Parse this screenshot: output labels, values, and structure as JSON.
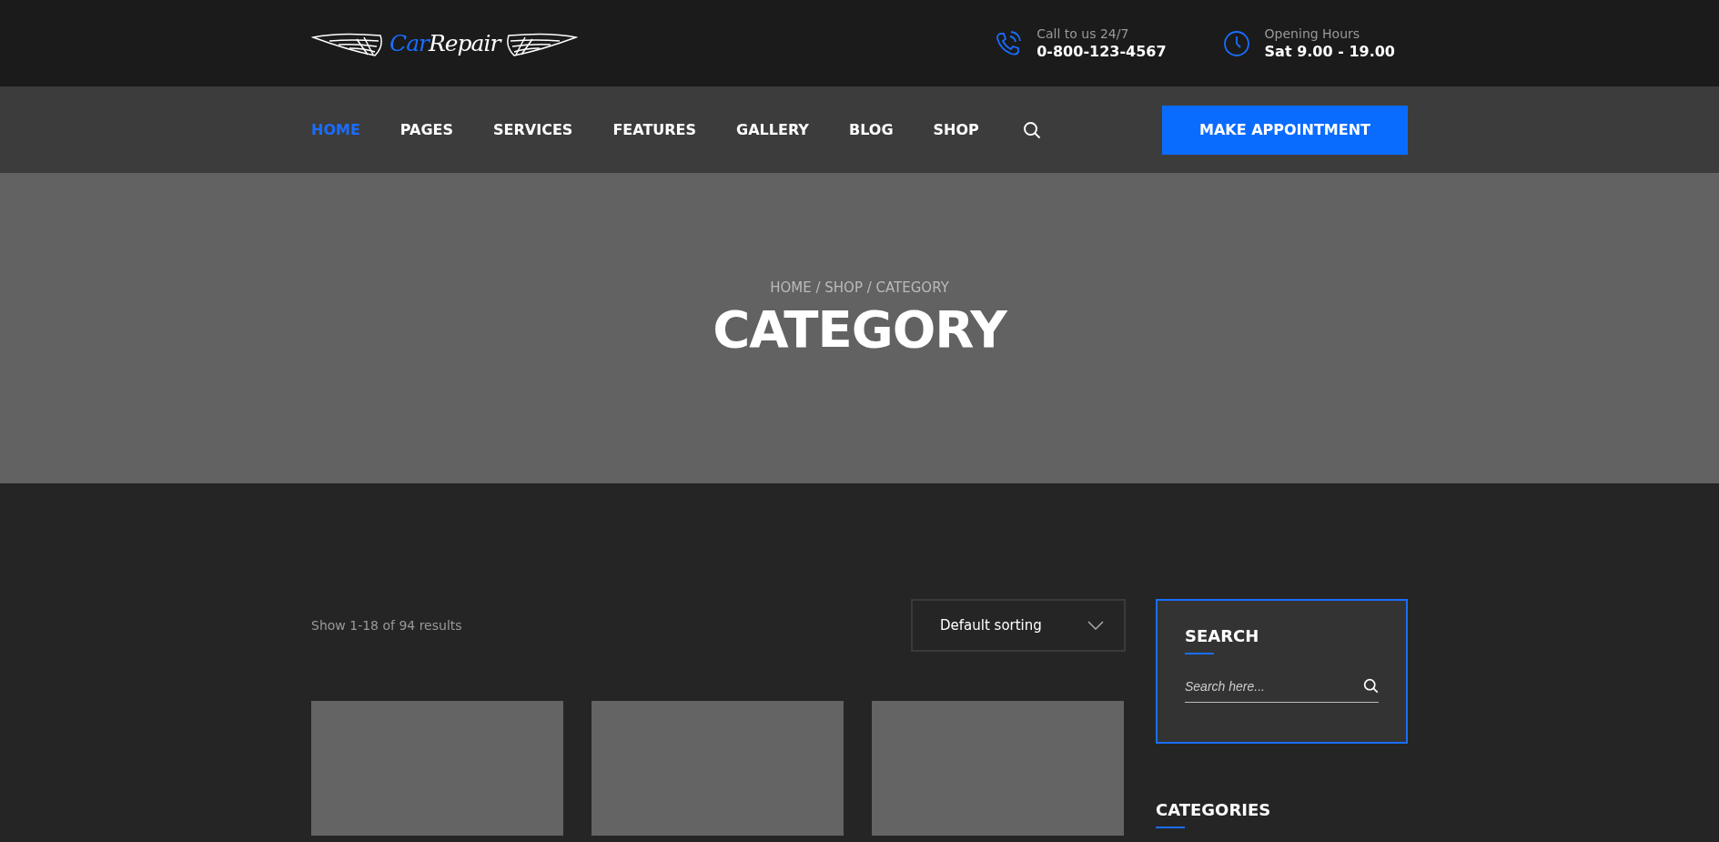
{
  "logo": {
    "parts": [
      {
        "text": "Car",
        "accent": true
      },
      {
        "text": "Repair",
        "accent": false
      }
    ]
  },
  "contacts": [
    {
      "kind": "phone",
      "label": "Call to us 24/7",
      "value": "0-800-123-4567"
    },
    {
      "kind": "clock",
      "label": "Opening Hours",
      "value": "Sat 9.00 - 19.00"
    }
  ],
  "nav": {
    "items": [
      {
        "label": "HOME",
        "selected": true
      },
      {
        "label": "PAGES",
        "selected": false
      },
      {
        "label": "SERVICES",
        "selected": false
      },
      {
        "label": "FEATURES",
        "selected": false
      },
      {
        "label": "GALLERY",
        "selected": false
      },
      {
        "label": "BLOG",
        "selected": false
      },
      {
        "label": "SHOP",
        "selected": false
      }
    ],
    "button": "MAKE APPOINTMENT"
  },
  "hero": {
    "breadcrumb": "HOME / SHOP / CATEGORY",
    "title": "CATEGORY"
  },
  "shop": {
    "result_count": "Show 1-18 of 94 results",
    "sort": "Default sorting"
  },
  "sidebar": {
    "search": {
      "title": "SEARCH",
      "placeholder": "Search here..."
    },
    "categories": {
      "title": "CATEGORIES"
    }
  }
}
